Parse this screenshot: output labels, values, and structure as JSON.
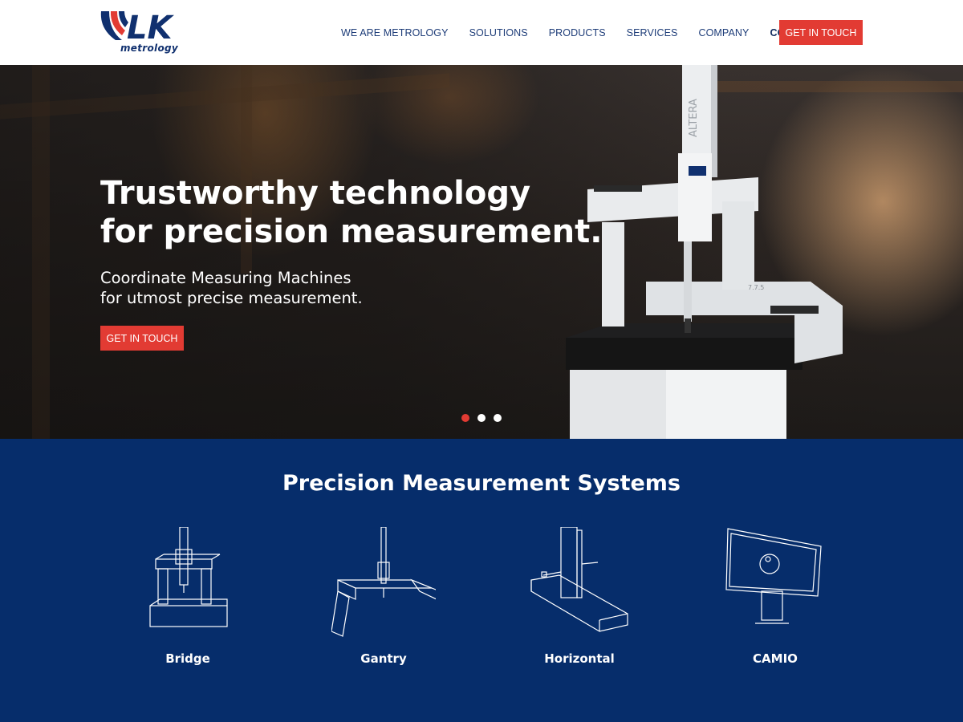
{
  "header": {
    "logo_text": "LK",
    "logo_subtext": "metrology",
    "nav": [
      {
        "label": "WE ARE METROLOGY"
      },
      {
        "label": "SOLUTIONS"
      },
      {
        "label": "PRODUCTS"
      },
      {
        "label": "SERVICES"
      },
      {
        "label": "COMPANY"
      },
      {
        "label": "CONTACT"
      }
    ],
    "cta_label": "GET IN TOUCH"
  },
  "hero": {
    "title_line1": "Trustworthy technology",
    "title_line2": "for precision measurement.",
    "subtitle_line1": "Coordinate Measuring Machines",
    "subtitle_line2": "for utmost precise measurement.",
    "cta_label": "GET IN TOUCH",
    "machine_brand": "ALTERA",
    "machine_model": "7.7.5",
    "carousel_dots": 3,
    "carousel_active_index": 0
  },
  "products": {
    "title": "Precision Measurement Systems",
    "items": [
      {
        "label": "Bridge",
        "icon": "bridge-cmm-icon"
      },
      {
        "label": "Gantry",
        "icon": "gantry-cmm-icon"
      },
      {
        "label": "Horizontal",
        "icon": "horizontal-cmm-icon"
      },
      {
        "label": "CAMIO",
        "icon": "camio-monitor-icon"
      }
    ]
  },
  "colors": {
    "brand_blue": "#062d6b",
    "accent_red": "#e23b33",
    "nav_text": "#1d3c78"
  }
}
